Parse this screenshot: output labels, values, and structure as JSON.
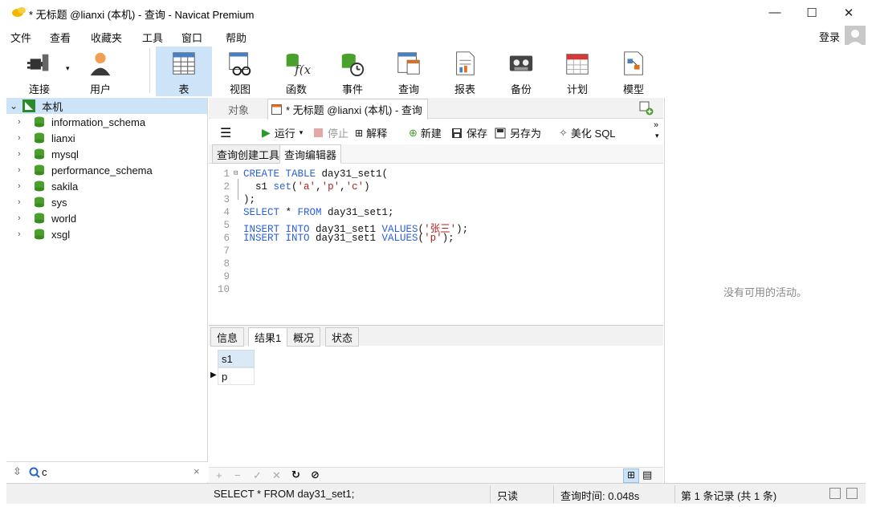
{
  "window": {
    "title": "* 无标题 @lianxi (本机) - 查询 - Navicat Premium",
    "minimize_glyph": "—",
    "maximize_glyph": "☐",
    "close_glyph": "✕"
  },
  "menu": [
    "文件",
    "查看",
    "收藏夹",
    "工具",
    "窗口",
    "帮助"
  ],
  "login_label": "登录",
  "toolbar": {
    "items": [
      {
        "label": "连接",
        "icon": "plug-icon"
      },
      {
        "label": "用户",
        "icon": "user-icon"
      },
      {
        "label": "表",
        "icon": "table-icon"
      },
      {
        "label": "视图",
        "icon": "view-icon"
      },
      {
        "label": "函数",
        "icon": "function-icon"
      },
      {
        "label": "事件",
        "icon": "event-icon"
      },
      {
        "label": "查询",
        "icon": "query-icon"
      },
      {
        "label": "报表",
        "icon": "report-icon"
      },
      {
        "label": "备份",
        "icon": "backup-icon"
      },
      {
        "label": "计划",
        "icon": "schedule-icon"
      },
      {
        "label": "模型",
        "icon": "model-icon"
      }
    ],
    "active": "表"
  },
  "tree": {
    "root": "本机",
    "databases": [
      "information_schema",
      "lianxi",
      "mysql",
      "performance_schema",
      "sakila",
      "sys",
      "world",
      "xsgl"
    ]
  },
  "left_search": {
    "value": "c"
  },
  "tabs": {
    "objects": "对象",
    "query": "* 无标题 @lianxi (本机) - 查询"
  },
  "query_toolbar": {
    "run": "运行",
    "stop": "停止",
    "explain": "解释",
    "new": "新建",
    "save": "保存",
    "save_as": "另存为",
    "beautify": "美化 SQL"
  },
  "sub_tabs": [
    "查询创建工具",
    "查询编辑器"
  ],
  "editor": {
    "line_numbers": [
      "1",
      "2",
      "3",
      "4",
      "5",
      "6",
      "7",
      "8",
      "9",
      "10"
    ]
  },
  "result_tabs": [
    "信息",
    "结果1",
    "概况",
    "状态"
  ],
  "result_grid": {
    "column": "s1",
    "rows": [
      "p"
    ]
  },
  "right_pane": {
    "empty_message": "没有可用的活动。"
  },
  "status_bar": {
    "sql": "SELECT * FROM day31_set1;",
    "readonly": "只读",
    "query_time": "查询时间: 0.048s",
    "record": "第 1 条记录 (共 1 条)"
  },
  "colors": {
    "accent": "#cde3f7",
    "keyword": "#2b5fd9",
    "string": "#b02020",
    "db_icon": "#4aa02c"
  }
}
